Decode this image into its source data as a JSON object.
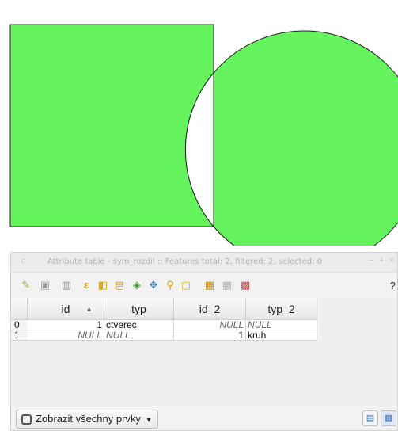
{
  "window": {
    "title": "Attribute table - sym_rozdil :: Features total: 2, filtered: 2, selected: 0",
    "help_label": "?"
  },
  "toolbar": {
    "icons": [
      "pencil-icon",
      "save-icon",
      "delete-icon",
      "expression-icon",
      "select-icon",
      "invert-selection-icon",
      "deselect-icon",
      "pan-icon",
      "zoom-icon",
      "new-field-icon",
      "delete-field-icon",
      "field-calculator-icon"
    ]
  },
  "table": {
    "columns": [
      {
        "label": "id",
        "sort": "▲"
      },
      {
        "label": "typ"
      },
      {
        "label": "id_2"
      },
      {
        "label": "typ_2"
      }
    ],
    "rows": [
      {
        "num": "0",
        "id": "1",
        "typ": "ctverec",
        "id_2": "NULL",
        "typ_2": "NULL"
      },
      {
        "num": "1",
        "id": "NULL",
        "typ": "NULL",
        "id_2": "1",
        "typ_2": "kruh"
      }
    ]
  },
  "footer": {
    "filter_label": "Zobrazit všechny prvky",
    "filter_arrow": "▾"
  },
  "colors": {
    "feature_fill": "#66f45e",
    "feature_stroke": "#222222"
  }
}
